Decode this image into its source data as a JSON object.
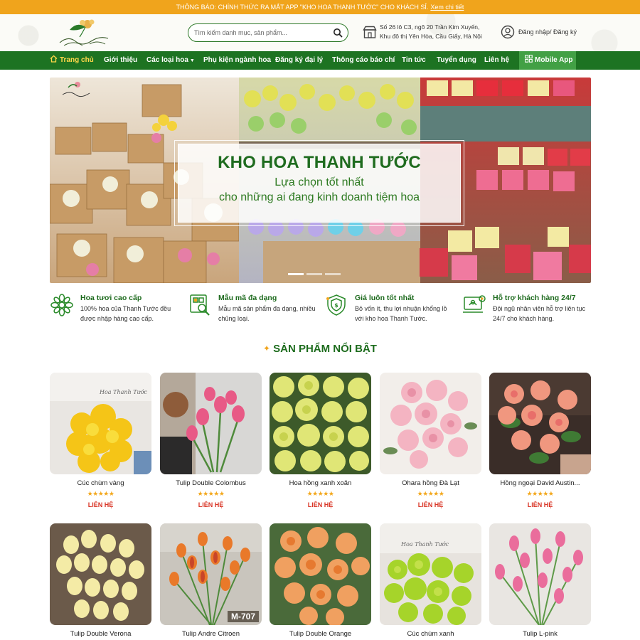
{
  "topbar": {
    "text": "THÔNG BÁO: CHÍNH THỨC RA MẮT APP \"KHO HOA THANH TƯỚC\" CHO KHÁCH SỈ.",
    "link": "Xem chi tiết"
  },
  "header": {
    "search_placeholder": "Tìm kiếm danh mục, sản phẩm...",
    "address_line1": "Số 26 lô C3, ngõ 20 Trần Kim Xuyến,",
    "address_line2": "Khu đô thị Yên Hòa, Cầu Giấy, Hà Nội",
    "login": "Đăng nhập/ Đăng ký"
  },
  "nav": {
    "items": [
      "Trang chủ",
      "Giới thiệu",
      "Các loại hoa",
      "Phụ kiện ngành hoa",
      "Đăng ký đại lý",
      "Thông cáo báo chí",
      "Tin tức",
      "Tuyển dụng",
      "Liên hệ"
    ],
    "mobile": "Mobile App"
  },
  "hero": {
    "title": "KHO HOA THANH TƯỚC",
    "sub1": "Lựa chọn tốt nhất",
    "sub2": "cho những ai đang kinh doanh tiệm hoa"
  },
  "features": [
    {
      "icon": "flower-icon",
      "title": "Hoa tươi cao cấp",
      "desc": "100% hoa của Thanh Tước đều được nhập hàng cao cấp."
    },
    {
      "icon": "design-search-icon",
      "title": "Mẫu mã đa dạng",
      "desc": "Mẫu mã sản phẩm đa dạng, nhiều chủng loại."
    },
    {
      "icon": "price-shield-icon",
      "title": "Giá luôn tốt nhất",
      "desc": "Bỏ vốn ít, thu lợi nhuận khổng lồ với kho hoa Thanh Tước."
    },
    {
      "icon": "support-laptop-icon",
      "title": "Hỗ trợ khách hàng 24/7",
      "desc": "Đội ngũ nhân viên hỗ trợ liên tục 24/7 cho khách hàng."
    }
  ],
  "section": {
    "title": "SẢN PHẨM NỔI BẬT"
  },
  "products": [
    {
      "name": "Cúc chùm vàng",
      "stars": "★★★★★",
      "price": "LIÊN HỆ"
    },
    {
      "name": "Tulip Double Colombus",
      "stars": "★★★★★",
      "price": "LIÊN HỆ"
    },
    {
      "name": "Hoa hồng xanh xoăn",
      "stars": "★★★★★",
      "price": "LIÊN HỆ"
    },
    {
      "name": "Ohara hồng Đà Lạt",
      "stars": "★★★★★",
      "price": "LIÊN HỆ"
    },
    {
      "name": "Hồng ngoại David Austin...",
      "stars": "★★★★★",
      "price": "LIÊN HỆ"
    },
    {
      "name": "Tulip Double Verona",
      "tag": ""
    },
    {
      "name": "Tulip Andre Citroen",
      "tag": "M-707"
    },
    {
      "name": "Tulip Double Orange",
      "tag": ""
    },
    {
      "name": "Cúc chùm xanh",
      "tag": ""
    },
    {
      "name": "Tulip L-pink",
      "tag": ""
    }
  ],
  "colors": {
    "brand_green": "#1d7322",
    "accent_orange": "#f0a41c",
    "price_red": "#d93526"
  }
}
